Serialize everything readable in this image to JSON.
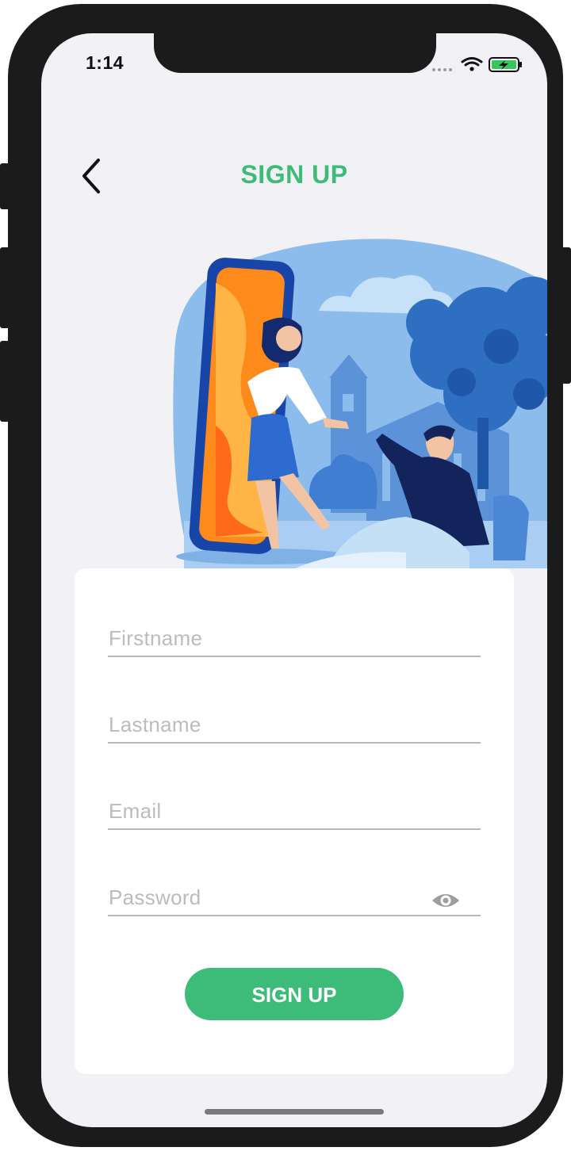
{
  "status_bar": {
    "time": "1:14"
  },
  "header": {
    "title": "SIGN UP",
    "back_icon": "chevron-left-icon"
  },
  "form": {
    "firstname_placeholder": "Firstname",
    "lastname_placeholder": "Lastname",
    "email_placeholder": "Email",
    "password_placeholder": "Password",
    "password_toggle_icon": "eye-icon",
    "submit_label": "SIGN UP"
  },
  "colors": {
    "accent": "#3dbb78",
    "background": "#f2f1f6",
    "card": "#ffffff",
    "frame": "#1b1b1b"
  }
}
